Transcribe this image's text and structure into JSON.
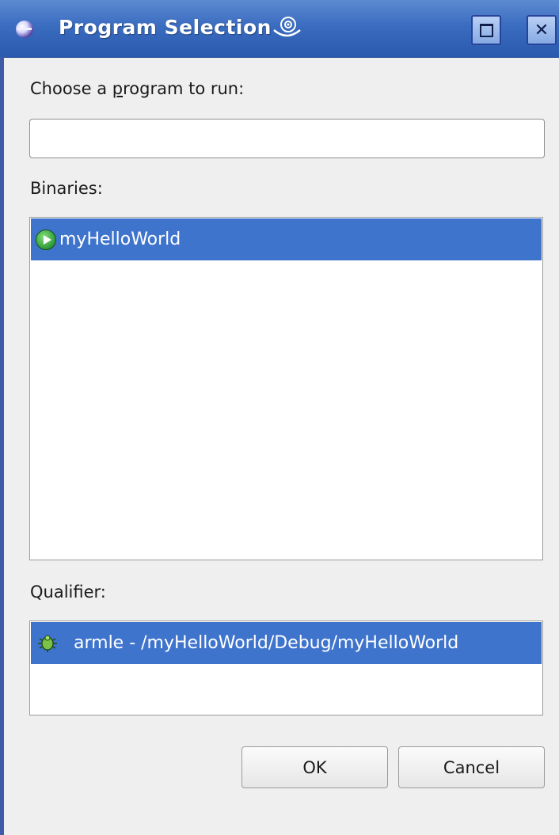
{
  "window": {
    "title": "Program Selection"
  },
  "prompt": {
    "label_before": "Choose a ",
    "label_mnemonic": "p",
    "label_after": "rogram to run:",
    "input_value": "",
    "input_placeholder": ""
  },
  "binaries": {
    "label": "Binaries:",
    "items": [
      {
        "label": "myHelloWorld",
        "icon": "binary-run-icon",
        "selected": true
      }
    ]
  },
  "qualifier": {
    "label": "Qualifier:",
    "items": [
      {
        "label": "armle - /myHelloWorld/Debug/myHelloWorld",
        "icon": "bug-icon",
        "selected": true
      }
    ]
  },
  "buttons": {
    "ok": "OK",
    "cancel": "Cancel"
  },
  "colors": {
    "titlebar": "#3a6cc0",
    "selection": "#3f74cd",
    "dialog_bg": "#efefef"
  }
}
